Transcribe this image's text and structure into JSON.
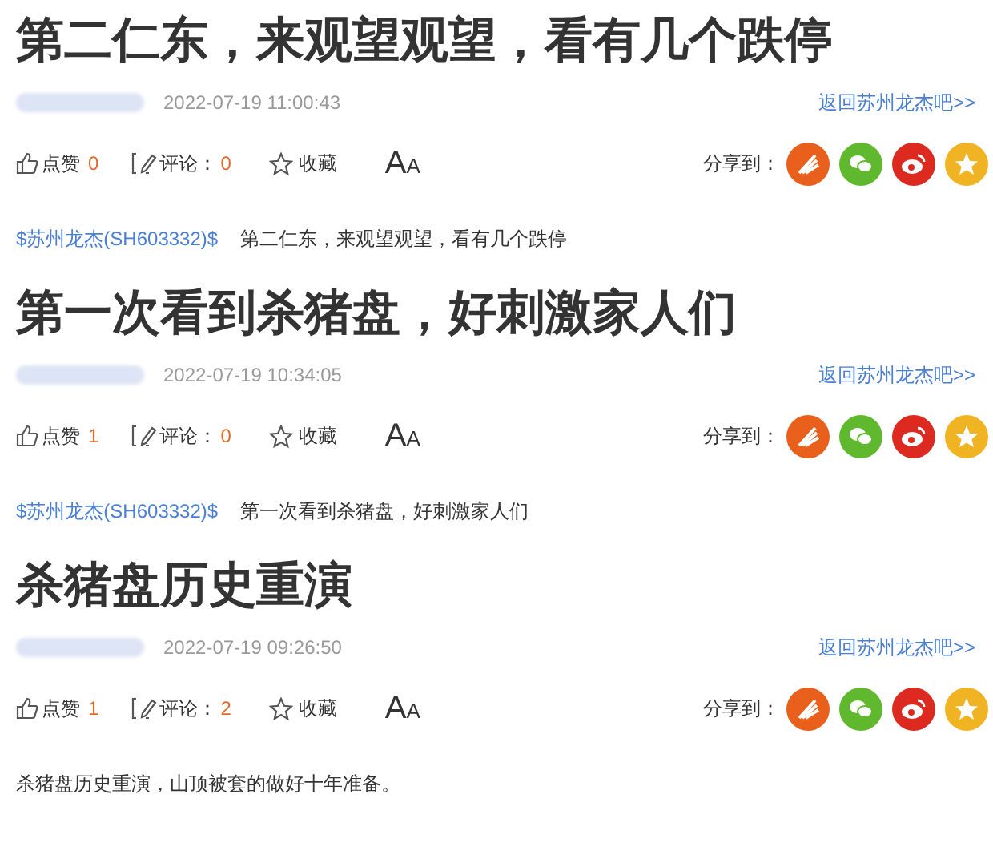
{
  "posts": [
    {
      "title": "第二仁东，来观望观望，看有几个跌停",
      "time": "2022-07-19 11:00:43",
      "back_link": "返回苏州龙杰吧>>",
      "like_label": "点赞",
      "like_count": "0",
      "comment_label": "评论：",
      "comment_count": "0",
      "favorite_label": "收藏",
      "font_toggle": [
        "A",
        "A"
      ],
      "share_label": "分享到：",
      "body": {
        "stock_tag": "$苏州龙杰(SH603332)$",
        "text": "第二仁东，来观望观望，看有几个跌停"
      }
    },
    {
      "title": "第一次看到杀猪盘，好刺激家人们",
      "time": "2022-07-19 10:34:05",
      "back_link": "返回苏州龙杰吧>>",
      "like_label": "点赞",
      "like_count": "1",
      "comment_label": "评论：",
      "comment_count": "0",
      "favorite_label": "收藏",
      "font_toggle": [
        "A",
        "A"
      ],
      "share_label": "分享到：",
      "body": {
        "stock_tag": "$苏州龙杰(SH603332)$",
        "text": "第一次看到杀猪盘，好刺激家人们"
      }
    },
    {
      "title": "杀猪盘历史重演",
      "time": "2022-07-19 09:26:50",
      "back_link": "返回苏州龙杰吧>>",
      "like_label": "点赞",
      "like_count": "1",
      "comment_label": "评论：",
      "comment_count": "2",
      "favorite_label": "收藏",
      "font_toggle": [
        "A",
        "A"
      ],
      "share_label": "分享到：",
      "body": {
        "text": "杀猪盘历史重演，山顶被套的做好十年准备。"
      }
    }
  ]
}
